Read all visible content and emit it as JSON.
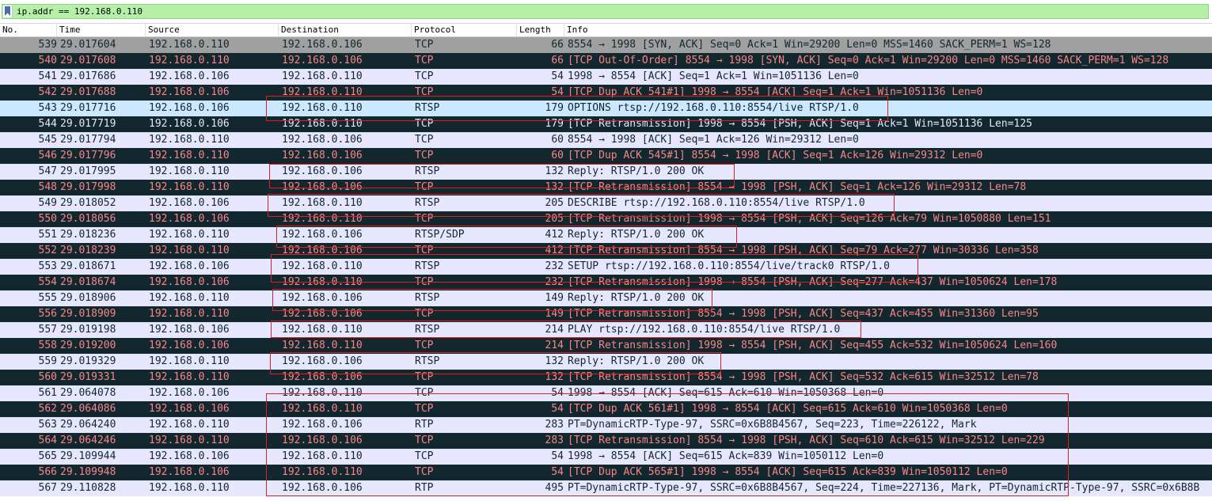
{
  "filter": {
    "value": "ip.addr == 192.168.0.110"
  },
  "columns": {
    "no": "No.",
    "time": "Time",
    "source": "Source",
    "destination": "Destination",
    "protocol": "Protocol",
    "length": "Length",
    "info": "Info"
  },
  "colors": {
    "filter_valid": "#b6f0a8",
    "row_normal_bg": "#e7e6ff",
    "row_bad_bg": "#12272e",
    "row_bad_fg": "#f78787",
    "row_syn_bg": "#a0a0a0",
    "selected_bg": "#cce8ff",
    "annotation_box": "#e02020"
  },
  "packets": [
    {
      "no": "539",
      "time": "29.017604",
      "src": "192.168.0.110",
      "dst": "192.168.0.106",
      "proto": "TCP",
      "len": "66",
      "info": "8554 → 1998 [SYN, ACK] Seq=0 Ack=1 Win=29200 Len=0 MSS=1460 SACK_PERM=1 WS=128",
      "style": "ack"
    },
    {
      "no": "540",
      "time": "29.017608",
      "src": "192.168.0.110",
      "dst": "192.168.0.106",
      "proto": "TCP",
      "len": "66",
      "info": "[TCP Out-Of-Order] 8554 → 1998 [SYN, ACK] Seq=0 Ack=1 Win=29200 Len=0 MSS=1460 SACK_PERM=1 WS=128",
      "style": "bad"
    },
    {
      "no": "541",
      "time": "29.017686",
      "src": "192.168.0.106",
      "dst": "192.168.0.110",
      "proto": "TCP",
      "len": "54",
      "info": "1998 → 8554 [ACK] Seq=1 Ack=1 Win=1051136 Len=0",
      "style": "normal"
    },
    {
      "no": "542",
      "time": "29.017688",
      "src": "192.168.0.106",
      "dst": "192.168.0.110",
      "proto": "TCP",
      "len": "54",
      "info": "[TCP Dup ACK 541#1] 1998 → 8554 [ACK] Seq=1 Ack=1 Win=1051136 Len=0",
      "style": "bad"
    },
    {
      "no": "543",
      "time": "29.017716",
      "src": "192.168.0.106",
      "dst": "192.168.0.110",
      "proto": "RTSP",
      "len": "179",
      "info": "OPTIONS rtsp://192.168.0.110:8554/live RTSP/1.0",
      "style": "selected"
    },
    {
      "no": "544",
      "time": "29.017719",
      "src": "192.168.0.106",
      "dst": "192.168.0.110",
      "proto": "TCP",
      "len": "179",
      "info": "[TCP Retransmission] 1998 → 8554 [PSH, ACK] Seq=1 Ack=1 Win=1051136 Len=125",
      "style": "selected-rel"
    },
    {
      "no": "545",
      "time": "29.017794",
      "src": "192.168.0.110",
      "dst": "192.168.0.106",
      "proto": "TCP",
      "len": "60",
      "info": "8554 → 1998 [ACK] Seq=1 Ack=126 Win=29312 Len=0",
      "style": "normal"
    },
    {
      "no": "546",
      "time": "29.017796",
      "src": "192.168.0.110",
      "dst": "192.168.0.106",
      "proto": "TCP",
      "len": "60",
      "info": "[TCP Dup ACK 545#1] 8554 → 1998 [ACK] Seq=1 Ack=126 Win=29312 Len=0",
      "style": "bad"
    },
    {
      "no": "547",
      "time": "29.017995",
      "src": "192.168.0.110",
      "dst": "192.168.0.106",
      "proto": "RTSP",
      "len": "132",
      "info": "Reply: RTSP/1.0 200 OK",
      "style": "normal"
    },
    {
      "no": "548",
      "time": "29.017998",
      "src": "192.168.0.110",
      "dst": "192.168.0.106",
      "proto": "TCP",
      "len": "132",
      "info": "[TCP Retransmission] 8554 → 1998 [PSH, ACK] Seq=1 Ack=126 Win=29312 Len=78",
      "style": "bad"
    },
    {
      "no": "549",
      "time": "29.018052",
      "src": "192.168.0.106",
      "dst": "192.168.0.110",
      "proto": "RTSP",
      "len": "205",
      "info": "DESCRIBE rtsp://192.168.0.110:8554/live RTSP/1.0",
      "style": "normal"
    },
    {
      "no": "550",
      "time": "29.018056",
      "src": "192.168.0.106",
      "dst": "192.168.0.110",
      "proto": "TCP",
      "len": "205",
      "info": "[TCP Retransmission] 1998 → 8554 [PSH, ACK] Seq=126 Ack=79 Win=1050880 Len=151",
      "style": "bad"
    },
    {
      "no": "551",
      "time": "29.018236",
      "src": "192.168.0.110",
      "dst": "192.168.0.106",
      "proto": "RTSP/SDP",
      "len": "412",
      "info": "Reply: RTSP/1.0 200 OK",
      "style": "normal"
    },
    {
      "no": "552",
      "time": "29.018239",
      "src": "192.168.0.110",
      "dst": "192.168.0.106",
      "proto": "TCP",
      "len": "412",
      "info": "[TCP Retransmission] 8554 → 1998 [PSH, ACK] Seq=79 Ack=277 Win=30336 Len=358",
      "style": "bad"
    },
    {
      "no": "553",
      "time": "29.018671",
      "src": "192.168.0.106",
      "dst": "192.168.0.110",
      "proto": "RTSP",
      "len": "232",
      "info": "SETUP rtsp://192.168.0.110:8554/live/track0 RTSP/1.0",
      "style": "normal"
    },
    {
      "no": "554",
      "time": "29.018674",
      "src": "192.168.0.106",
      "dst": "192.168.0.110",
      "proto": "TCP",
      "len": "232",
      "info": "[TCP Retransmission] 1998 → 8554 [PSH, ACK] Seq=277 Ack=437 Win=1050624 Len=178",
      "style": "bad"
    },
    {
      "no": "555",
      "time": "29.018906",
      "src": "192.168.0.110",
      "dst": "192.168.0.106",
      "proto": "RTSP",
      "len": "149",
      "info": "Reply: RTSP/1.0 200 OK",
      "style": "normal"
    },
    {
      "no": "556",
      "time": "29.018909",
      "src": "192.168.0.110",
      "dst": "192.168.0.106",
      "proto": "TCP",
      "len": "149",
      "info": "[TCP Retransmission] 8554 → 1998 [PSH, ACK] Seq=437 Ack=455 Win=31360 Len=95",
      "style": "bad"
    },
    {
      "no": "557",
      "time": "29.019198",
      "src": "192.168.0.106",
      "dst": "192.168.0.110",
      "proto": "RTSP",
      "len": "214",
      "info": "PLAY rtsp://192.168.0.110:8554/live RTSP/1.0",
      "style": "normal"
    },
    {
      "no": "558",
      "time": "29.019200",
      "src": "192.168.0.106",
      "dst": "192.168.0.110",
      "proto": "TCP",
      "len": "214",
      "info": "[TCP Retransmission] 1998 → 8554 [PSH, ACK] Seq=455 Ack=532 Win=1050624 Len=160",
      "style": "bad"
    },
    {
      "no": "559",
      "time": "29.019329",
      "src": "192.168.0.110",
      "dst": "192.168.0.106",
      "proto": "RTSP",
      "len": "132",
      "info": "Reply: RTSP/1.0 200 OK",
      "style": "normal"
    },
    {
      "no": "560",
      "time": "29.019331",
      "src": "192.168.0.110",
      "dst": "192.168.0.106",
      "proto": "TCP",
      "len": "132",
      "info": "[TCP Retransmission] 8554 → 1998 [PSH, ACK] Seq=532 Ack=615 Win=32512 Len=78",
      "style": "bad"
    },
    {
      "no": "561",
      "time": "29.064078",
      "src": "192.168.0.106",
      "dst": "192.168.0.110",
      "proto": "TCP",
      "len": "54",
      "info": "1998 → 8554 [ACK] Seq=615 Ack=610 Win=1050368 Len=0",
      "style": "normal"
    },
    {
      "no": "562",
      "time": "29.064086",
      "src": "192.168.0.106",
      "dst": "192.168.0.110",
      "proto": "TCP",
      "len": "54",
      "info": "[TCP Dup ACK 561#1] 1998 → 8554 [ACK] Seq=615 Ack=610 Win=1050368 Len=0",
      "style": "bad"
    },
    {
      "no": "563",
      "time": "29.064240",
      "src": "192.168.0.110",
      "dst": "192.168.0.106",
      "proto": "RTP",
      "len": "283",
      "info": "PT=DynamicRTP-Type-97, SSRC=0x6B8B4567, Seq=223, Time=226122, Mark",
      "style": "normal"
    },
    {
      "no": "564",
      "time": "29.064246",
      "src": "192.168.0.110",
      "dst": "192.168.0.106",
      "proto": "TCP",
      "len": "283",
      "info": "[TCP Retransmission] 8554 → 1998 [PSH, ACK] Seq=610 Ack=615 Win=32512 Len=229",
      "style": "bad"
    },
    {
      "no": "565",
      "time": "29.109944",
      "src": "192.168.0.106",
      "dst": "192.168.0.110",
      "proto": "TCP",
      "len": "54",
      "info": "1998 → 8554 [ACK] Seq=615 Ack=839 Win=1050112 Len=0",
      "style": "normal"
    },
    {
      "no": "566",
      "time": "29.109948",
      "src": "192.168.0.106",
      "dst": "192.168.0.110",
      "proto": "TCP",
      "len": "54",
      "info": "[TCP Dup ACK 565#1] 1998 → 8554 [ACK] Seq=615 Ack=839 Win=1050112 Len=0",
      "style": "bad"
    },
    {
      "no": "567",
      "time": "29.110828",
      "src": "192.168.0.110",
      "dst": "192.168.0.106",
      "proto": "RTP",
      "len": "495",
      "info": "PT=DynamicRTP-Type-97, SSRC=0x6B8B4567, Seq=224, Time=227136, Mark, PT=DynamicRTP-Type-97, SSRC=0x6B8B",
      "style": "normal"
    }
  ]
}
